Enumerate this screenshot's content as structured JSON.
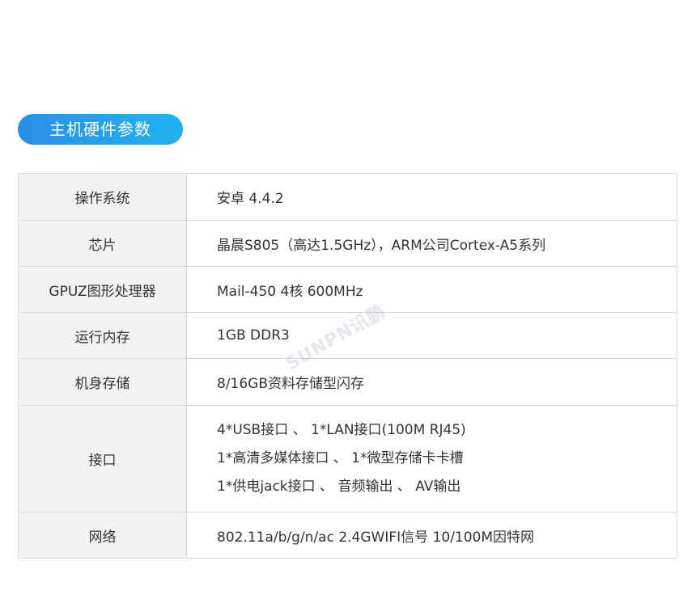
{
  "section": {
    "title": "主机硬件参数"
  },
  "specs": [
    {
      "label": "操作系统",
      "value": "安卓 4.4.2"
    },
    {
      "label": "芯片",
      "value": "晶晨S805（高达1.5GHz），ARM公司Cortex-A5系列"
    },
    {
      "label": "GPUZ图形处理器",
      "value": "Mail-450 4核 600MHz"
    },
    {
      "label": "运行内存",
      "value": "1GB DDR3"
    },
    {
      "label": "机身存储",
      "value": "8/16GB资料存储型闪存"
    },
    {
      "label": "接口",
      "lines": [
        "4*USB接口 、 1*LAN接口(100M RJ45)",
        "1*高清多媒体接口 、 1*微型存储卡卡槽",
        "1*供电jack接口 、 音频输出 、 AV输出"
      ]
    },
    {
      "label": "网络",
      "value": "802.11a/b/g/n/ac 2.4GWIFI信号 10/100M因特网"
    }
  ],
  "watermark": {
    "text": "SUNPN讯鹏"
  }
}
